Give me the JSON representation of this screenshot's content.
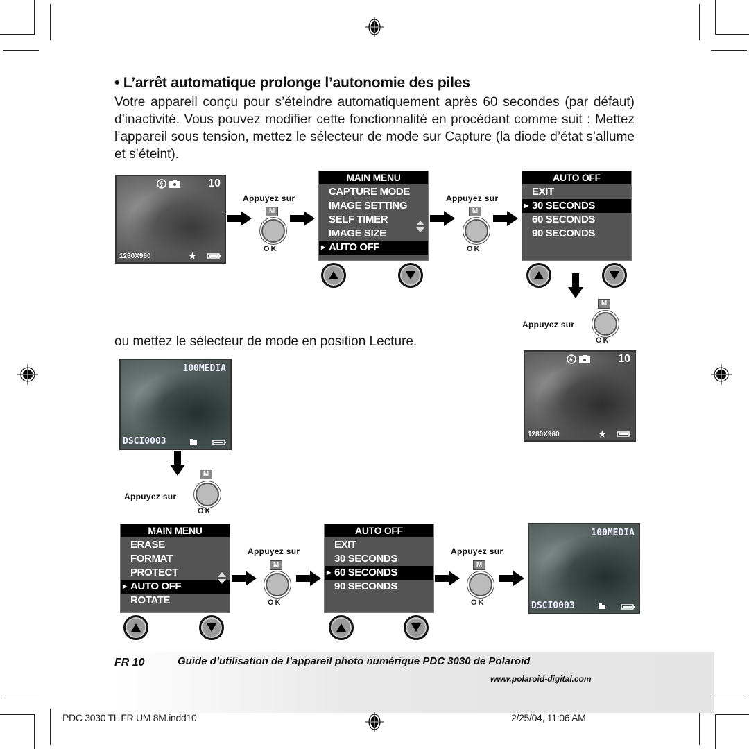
{
  "heading": "• L’arrêt automatique prolonge l’autonomie des piles",
  "body_paragraph": "Votre appareil conçu pour s’éteindre automatiquement après 60 secondes (par défaut) d’inactivité. Vous pouvez modifier cette fonctionnalité en procédant comme suit : Mettez l’appareil sous tension, mettez le sélecteur de mode sur Capture (la diode d’état s’allume et s’éteint).",
  "lecture_text": "ou mettez le sélecteur de mode en position Lecture.",
  "press_label": "Appuyez sur",
  "m_label": "M",
  "ok_label": "OK",
  "capture_screen": {
    "shots_remaining": "10",
    "resolution": "1280X960",
    "icons": [
      "flash-auto-icon",
      "camera-icon",
      "star-quality-icon",
      "battery-icon"
    ]
  },
  "playback_screen": {
    "folder": "100MEDIA",
    "filename": "DSCI0003",
    "icons": [
      "protect-icon",
      "battery-icon"
    ]
  },
  "capture_main_menu": {
    "title": "MAIN MENU",
    "items": [
      "CAPTURE MODE",
      "IMAGE SETTING",
      "SELF TIMER",
      "IMAGE SIZE",
      "AUTO OFF"
    ],
    "selected": "AUTO OFF"
  },
  "capture_auto_off_menu": {
    "title": "AUTO OFF",
    "items": [
      "EXIT",
      "30 SECONDS",
      "60 SECONDS",
      "90 SECONDS"
    ],
    "selected": "30 SECONDS"
  },
  "playback_main_menu": {
    "title": "MAIN MENU",
    "items": [
      "ERASE",
      "FORMAT",
      "PROTECT",
      "AUTO OFF",
      "ROTATE"
    ],
    "selected": "AUTO OFF"
  },
  "playback_auto_off_menu": {
    "title": "AUTO OFF",
    "items": [
      "EXIT",
      "30 SECONDS",
      "60 SECONDS",
      "90 SECONDS"
    ],
    "selected": "60 SECONDS"
  },
  "footer": {
    "page_label": "FR 10",
    "guide_title": "Guide d’utilisation de l’appareil photo numérique PDC 3030 de Polaroid",
    "url": "www.polaroid-digital.com"
  },
  "print_slug": {
    "filename": "PDC 3030 TL FR UM 8M.indd10",
    "timestamp": "2/25/04, 11:06 AM"
  }
}
